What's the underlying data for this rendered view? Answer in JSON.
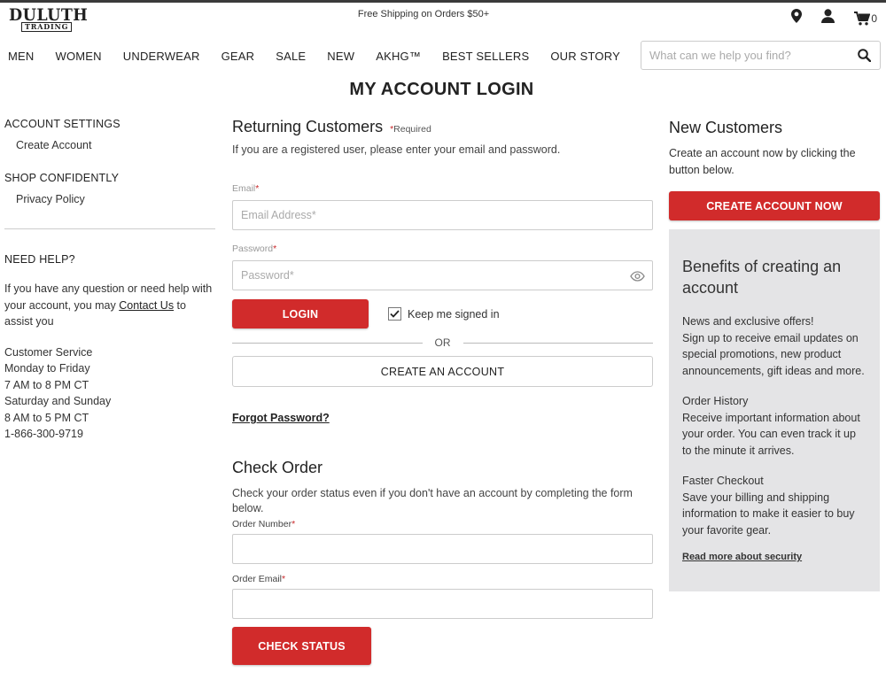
{
  "header": {
    "logo_text": "DULUTH",
    "logo_sub": "TRADING",
    "promo": "Free Shipping on Orders $50+",
    "cart_count": "0",
    "icons": [
      "location-pin-icon",
      "account-icon",
      "cart-icon"
    ]
  },
  "nav": {
    "items": [
      "MEN",
      "WOMEN",
      "UNDERWEAR",
      "GEAR",
      "SALE",
      "NEW",
      "AKHG™",
      "BEST SELLERS",
      "OUR STORY"
    ]
  },
  "search": {
    "placeholder": "What can we help you find?"
  },
  "page_title": "MY ACCOUNT LOGIN",
  "sidebar": {
    "account_settings": "ACCOUNT SETTINGS",
    "create_account": "Create Account",
    "shop_confidently": "SHOP CONFIDENTLY",
    "privacy_policy": "Privacy Policy",
    "need_help": "NEED HELP?",
    "help_text_before": "If you have any question or need help with your account, you may ",
    "contact_us": "Contact Us",
    "help_text_after": " to assist you",
    "service_lines": [
      "Customer Service",
      "Monday to Friday",
      "7 AM to 8 PM CT",
      "Saturday and Sunday",
      "8 AM to 5 PM CT",
      "1-866-300-9719"
    ]
  },
  "returning": {
    "title": "Returning Customers",
    "required_note": "Required",
    "intro": "If you are a registered user, please enter your email and password.",
    "email_label": "Email",
    "email_placeholder": "Email Address*",
    "password_label": "Password",
    "password_placeholder": "Password*",
    "login_button": "LOGIN",
    "keep_signed_in": "Keep me signed in",
    "keep_signed_in_checked": true,
    "or_text": "OR",
    "create_account_button": "CREATE AN ACCOUNT",
    "forgot_password": "Forgot Password?"
  },
  "check_order": {
    "title": "Check Order",
    "intro": "Check your order status even if you don't have an account by completing the form below.",
    "order_number_label": "Order Number",
    "order_email_label": "Order Email",
    "check_status_button": "CHECK STATUS"
  },
  "new_customers": {
    "title": "New Customers",
    "intro": "Create an account now by clicking the button below.",
    "create_now_button": "CREATE ACCOUNT NOW",
    "benefits_title": "Benefits of creating an account",
    "benefits": [
      {
        "heading": "News and exclusive offers!",
        "text": "Sign up to receive email updates on special promotions, new product announcements, gift ideas and more."
      },
      {
        "heading": "Order History",
        "text": "Receive important information about your order. You can even track it up to the minute it arrives."
      },
      {
        "heading": "Faster Checkout",
        "text": "Save your billing and shipping information to make it easier to buy your favorite gear."
      }
    ],
    "read_more": "Read more about security"
  },
  "colors": {
    "accent_red": "#d12b2b",
    "panel_gray": "#e4e4e6"
  }
}
